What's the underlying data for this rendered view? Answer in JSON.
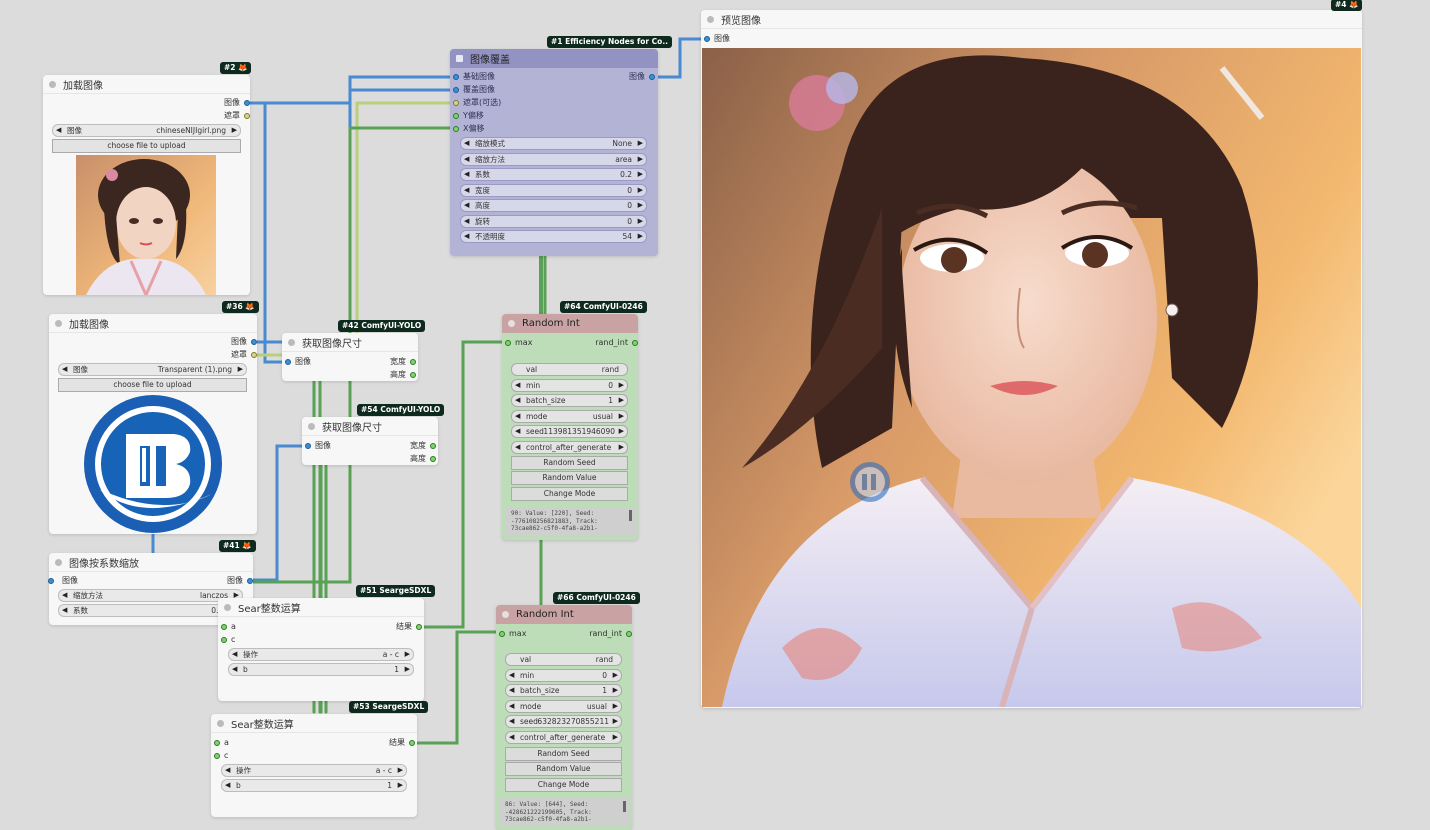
{
  "colors": {
    "wire_image": "#4a8ad0",
    "wire_int": "#58a155",
    "wire_mask": "#b8d07a"
  },
  "n2": {
    "badge": "#2 🦊",
    "title": "加载图像",
    "out_image": "图像",
    "out_mask": "遮罩",
    "w_image_label": "图像",
    "w_image_value": "chineseNIJIgirl.png",
    "upload": "choose file to upload",
    "preview": "portrait-thumbnail"
  },
  "n36": {
    "badge": "#36 🦊",
    "title": "加载图像",
    "out_image": "图像",
    "out_mask": "遮罩",
    "w_image_label": "图像",
    "w_image_value": "Transparent (1).png",
    "upload": "choose file to upload",
    "preview": "blue-b-logo"
  },
  "n41": {
    "badge": "#41 🦊",
    "title": "图像按系数缩放",
    "in_image": "图像",
    "out_image": "图像",
    "w_method_label": "缩放方法",
    "w_method_value": "lanczos",
    "w_factor_label": "系数",
    "w_factor_value": "0.20"
  },
  "n1": {
    "badge": "#1 Efficiency Nodes for Co..",
    "title": "图像覆盖",
    "in_base": "基础图像",
    "in_overlay": "覆盖图像",
    "in_mask": "遮罩(可选)",
    "in_y": "Y偏移",
    "in_x": "X偏移",
    "out_image": "图像",
    "widgets": [
      {
        "label": "缩放模式",
        "value": "None"
      },
      {
        "label": "缩放方法",
        "value": "area"
      },
      {
        "label": "系数",
        "value": "0.2"
      },
      {
        "label": "宽度",
        "value": "0"
      },
      {
        "label": "高度",
        "value": "0"
      },
      {
        "label": "旋转",
        "value": "0"
      },
      {
        "label": "不透明度",
        "value": "54"
      }
    ]
  },
  "n42": {
    "badge": "#42 ComfyUI-YOLO",
    "title": "获取图像尺寸",
    "in_image": "图像",
    "out_w": "宽度",
    "out_h": "高度"
  },
  "n54": {
    "badge": "#54 ComfyUI-YOLO",
    "title": "获取图像尺寸",
    "in_image": "图像",
    "out_w": "宽度",
    "out_h": "高度"
  },
  "n64": {
    "badge": "#64 ComfyUI-0246",
    "title": "Random Int",
    "in_max": "max",
    "out": "rand_int",
    "widgets": [
      {
        "label": "val",
        "value": "rand"
      },
      {
        "label": "min",
        "value": "0"
      },
      {
        "label": "batch_size",
        "value": "1"
      },
      {
        "label": "mode",
        "value": "usual"
      },
      {
        "label": "seed",
        "value": "113981351946090"
      },
      {
        "label": "control_after_generate",
        "value": ""
      }
    ],
    "buttons": [
      "Random Seed",
      "Random Value",
      "Change Mode"
    ],
    "log": "90: Value: [220], Seed:\n-776108256821883, Track:\n73cae862-c5f0-4fa8-a2b1-"
  },
  "n66": {
    "badge": "#66 ComfyUI-0246",
    "title": "Random Int",
    "in_max": "max",
    "out": "rand_int",
    "widgets": [
      {
        "label": "val",
        "value": "rand"
      },
      {
        "label": "min",
        "value": "0"
      },
      {
        "label": "batch_size",
        "value": "1"
      },
      {
        "label": "mode",
        "value": "usual"
      },
      {
        "label": "seed",
        "value": "632823270855211"
      },
      {
        "label": "control_after_generate",
        "value": ""
      }
    ],
    "buttons": [
      "Random Seed",
      "Random Value",
      "Change Mode"
    ],
    "log": "86: Value: [644], Seed:\n-428621222199605, Track:\n73cae862-c5f0-4fa8-a2b1-"
  },
  "n51": {
    "badge": "#51 SeargeSDXL",
    "title": "Sear整数运算",
    "in_a": "a",
    "in_c": "c",
    "out": "结果",
    "w_op_label": "操作",
    "w_op_value": "a - c",
    "w_b_label": "b",
    "w_b_value": "1"
  },
  "n53": {
    "badge": "#53 SeargeSDXL",
    "title": "Sear整数运算",
    "in_a": "a",
    "in_c": "c",
    "out": "结果",
    "w_op_label": "操作",
    "w_op_value": "a - c",
    "w_b_label": "b",
    "w_b_value": "1"
  },
  "n4": {
    "badge": "#4 🦊",
    "title": "预览图像",
    "in_image": "图像",
    "preview": "portrait-preview-with-logo-watermark"
  }
}
